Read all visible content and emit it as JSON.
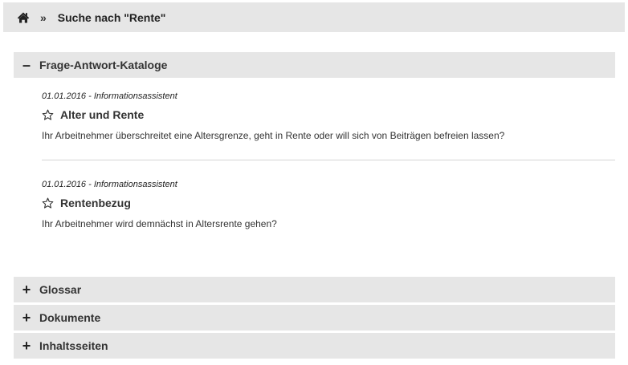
{
  "breadcrumb": {
    "home_icon": "home-icon",
    "separator": "»",
    "current": "Suche nach \"Rente\""
  },
  "sections": [
    {
      "title": "Frage-Antwort-Kataloge",
      "expanded": true,
      "sign": "–",
      "entries": [
        {
          "meta": "01.01.2016 - Informationsassistent",
          "title": "Alter und Rente",
          "description": "Ihr Arbeitnehmer überschreitet eine Altersgrenze, geht in Rente oder will sich von Beiträgen befreien lassen?",
          "icon": "star-outline-icon"
        },
        {
          "meta": "01.01.2016 - Informationsassistent",
          "title": "Rentenbezug",
          "description": "Ihr Arbeitnehmer wird demnächst in Altersrente gehen?",
          "icon": "star-outline-icon"
        }
      ]
    },
    {
      "title": "Glossar",
      "expanded": false,
      "sign": "+"
    },
    {
      "title": "Dokumente",
      "expanded": false,
      "sign": "+"
    },
    {
      "title": "Inhaltsseiten",
      "expanded": false,
      "sign": "+"
    }
  ],
  "colors": {
    "header_bg": "#e6e6e6",
    "text": "#333333",
    "divider": "#d4d4d4"
  }
}
